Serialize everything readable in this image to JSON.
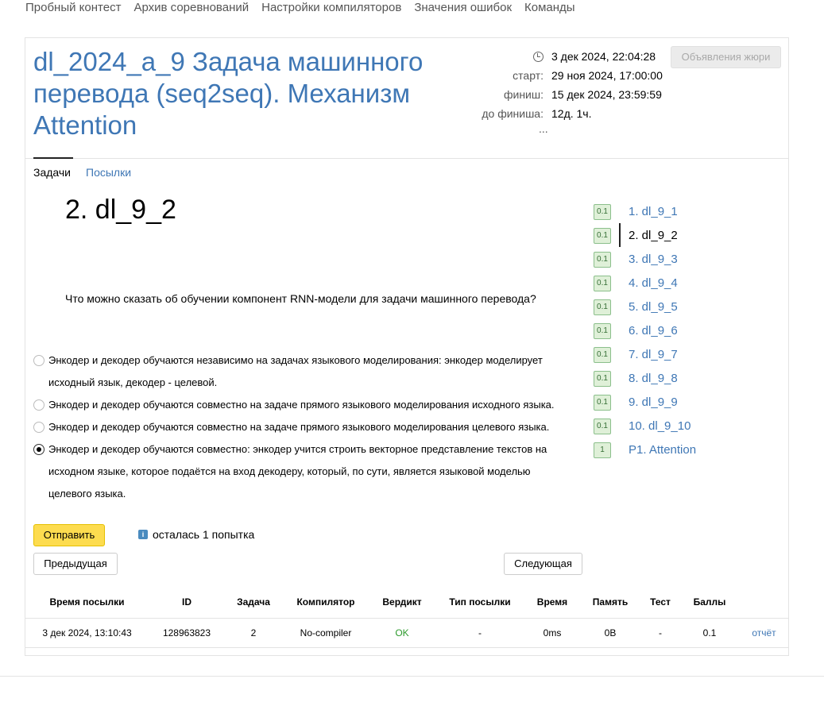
{
  "topnav": [
    "Пробный контест",
    "Архив соревнований",
    "Настройки компиляторов",
    "Значения ошибок",
    "Команды"
  ],
  "contest": {
    "title": "dl_2024_a_9 Задача машинного перевода (seq2seq). Механизм Attention",
    "current_time": "3 дек 2024, 22:04:28",
    "start_label": "старт:",
    "start_value": "29 ноя 2024, 17:00:00",
    "finish_label": "финиш:",
    "finish_value": "15 дек 2024, 23:59:59",
    "remaining_label": "до финиша:",
    "remaining_value": "12д. 1ч.",
    "more": "...",
    "jury_button": "Объявления жюри"
  },
  "tabs": [
    "Задачи",
    "Посылки"
  ],
  "problem": {
    "title": "2. dl_9_2",
    "question": "Что можно сказать об обучении компонент RNN-модели для задачи машинного перевода?",
    "options": [
      {
        "text": "Энкодер и декодер обучаются независимо на задачах языкового моделирования: энкодер моделирует исходный язык, декодер - целевой.",
        "checked": false
      },
      {
        "text": "Энкодер и декодер обучаются совместно на задаче прямого языкового моделирования исходного языка.",
        "checked": false
      },
      {
        "text": "Энкодер и декодер обучаются совместно на задаче прямого языкового моделирования целевого языка.",
        "checked": false
      },
      {
        "text": "Энкодер и декодер обучаются совместно: энкодер учится строить векторное представление текстов на исходном языке, которое подаётся на вход декодеру, который, по сути, является языковой моделью целевого языка.",
        "checked": true
      }
    ],
    "submit_label": "Отправить",
    "attempts_text": "осталась 1 попытка",
    "prev_label": "Предыдущая",
    "next_label": "Следующая"
  },
  "submissions": {
    "headers": [
      "Время посылки",
      "ID",
      "Задача",
      "Компилятор",
      "Вердикт",
      "Тип посылки",
      "Время",
      "Память",
      "Тест",
      "Баллы",
      ""
    ],
    "rows": [
      [
        "3 дек 2024, 13:10:43",
        "128963823",
        "2",
        "No-compiler",
        "OK",
        "-",
        "0ms",
        "0B",
        "-",
        "0.1",
        "отчёт"
      ]
    ]
  },
  "problem_list": [
    {
      "score": "0.1",
      "label": "1. dl_9_1",
      "active": false
    },
    {
      "score": "0.1",
      "label": "2. dl_9_2",
      "active": true
    },
    {
      "score": "0.1",
      "label": "3. dl_9_3",
      "active": false
    },
    {
      "score": "0.1",
      "label": "4. dl_9_4",
      "active": false
    },
    {
      "score": "0.1",
      "label": "5. dl_9_5",
      "active": false
    },
    {
      "score": "0.1",
      "label": "6. dl_9_6",
      "active": false
    },
    {
      "score": "0.1",
      "label": "7. dl_9_7",
      "active": false
    },
    {
      "score": "0.1",
      "label": "8. dl_9_8",
      "active": false
    },
    {
      "score": "0.1",
      "label": "9. dl_9_9",
      "active": false
    },
    {
      "score": "0.1",
      "label": "10. dl_9_10",
      "active": false
    },
    {
      "score": "1",
      "label": "P1. Attention",
      "active": false
    }
  ],
  "colors": {
    "link": "#3f77b5",
    "submit": "#fddc4f",
    "ok": "#2e9b2e",
    "badge_bg": "#dff0d8"
  },
  "icons": {
    "clock": "clock-icon",
    "info": "info-icon"
  }
}
